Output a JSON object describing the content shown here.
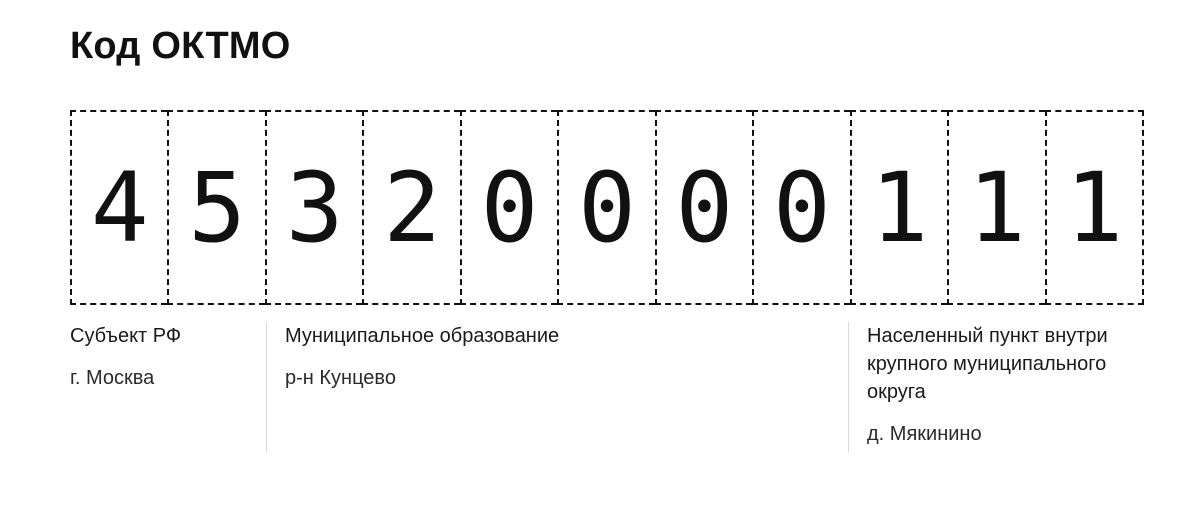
{
  "title": "Код ОКТМО",
  "digits": [
    "4",
    "5",
    "3",
    "2",
    "0",
    "0",
    "0",
    "0",
    "1",
    "1",
    "1"
  ],
  "groups": [
    {
      "heading": "Субъект РФ",
      "value": "г. Москва"
    },
    {
      "heading": "Муниципальное образование",
      "value": "р-н Кунцево"
    },
    {
      "heading": "Населенный пункт внутри крупного муниципального округа",
      "value": "д. Мякинино"
    }
  ]
}
